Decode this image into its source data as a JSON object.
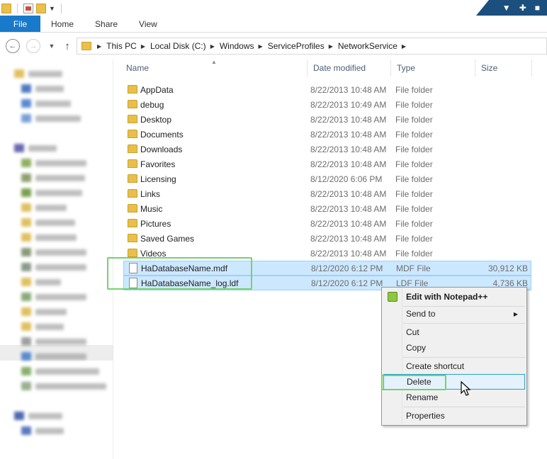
{
  "ribbon": {
    "tabs": [
      "File",
      "Home",
      "Share",
      "View"
    ]
  },
  "address": {
    "crumbs": [
      "This PC",
      "Local Disk (C:)",
      "Windows",
      "ServiceProfiles",
      "NetworkService"
    ]
  },
  "columns": {
    "name": "Name",
    "date": "Date modified",
    "type": "Type",
    "size": "Size"
  },
  "files": [
    {
      "name": "AppData",
      "date": "8/22/2013 10:48 AM",
      "type": "File folder",
      "size": "",
      "kind": "folder"
    },
    {
      "name": "debug",
      "date": "8/22/2013 10:49 AM",
      "type": "File folder",
      "size": "",
      "kind": "folder"
    },
    {
      "name": "Desktop",
      "date": "8/22/2013 10:48 AM",
      "type": "File folder",
      "size": "",
      "kind": "folder"
    },
    {
      "name": "Documents",
      "date": "8/22/2013 10:48 AM",
      "type": "File folder",
      "size": "",
      "kind": "folder"
    },
    {
      "name": "Downloads",
      "date": "8/22/2013 10:48 AM",
      "type": "File folder",
      "size": "",
      "kind": "folder"
    },
    {
      "name": "Favorites",
      "date": "8/22/2013 10:48 AM",
      "type": "File folder",
      "size": "",
      "kind": "folder"
    },
    {
      "name": "Licensing",
      "date": "8/12/2020 6:06 PM",
      "type": "File folder",
      "size": "",
      "kind": "folder"
    },
    {
      "name": "Links",
      "date": "8/22/2013 10:48 AM",
      "type": "File folder",
      "size": "",
      "kind": "folder"
    },
    {
      "name": "Music",
      "date": "8/22/2013 10:48 AM",
      "type": "File folder",
      "size": "",
      "kind": "folder"
    },
    {
      "name": "Pictures",
      "date": "8/22/2013 10:48 AM",
      "type": "File folder",
      "size": "",
      "kind": "folder"
    },
    {
      "name": "Saved Games",
      "date": "8/22/2013 10:48 AM",
      "type": "File folder",
      "size": "",
      "kind": "folder"
    },
    {
      "name": "Videos",
      "date": "8/22/2013 10:48 AM",
      "type": "File folder",
      "size": "",
      "kind": "folder"
    },
    {
      "name": "HaDatabaseName.mdf",
      "date": "8/12/2020 6:12 PM",
      "type": "MDF File",
      "size": "30,912 KB",
      "kind": "file",
      "selected": true
    },
    {
      "name": "HaDatabaseName_log.ldf",
      "date": "8/12/2020 6:12 PM",
      "type": "LDF File",
      "size": "4,736 KB",
      "kind": "file",
      "selected": true
    }
  ],
  "context_menu": {
    "items": [
      {
        "label": "Edit with Notepad++",
        "bold": true
      },
      {
        "label": "Send to",
        "submenu": true
      },
      {
        "label": "Cut"
      },
      {
        "label": "Copy"
      },
      {
        "label": "Create shortcut"
      },
      {
        "label": "Delete",
        "hover": true
      },
      {
        "label": "Rename"
      },
      {
        "label": "Properties"
      }
    ]
  },
  "colors": {
    "accent": "#1979ca",
    "selection": "#cce8ff",
    "highlight_box": "#73d36b",
    "window_control_bg": "#1b4f7d"
  }
}
